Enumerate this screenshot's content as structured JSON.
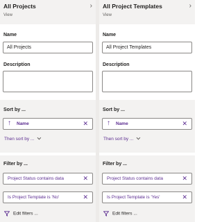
{
  "panels": [
    {
      "title": "All Projects",
      "subtitle": "View",
      "name_label": "Name",
      "name_value": "All Projects",
      "description_label": "Description",
      "description_value": "",
      "sort_label": "Sort by ...",
      "sort_field": "Name",
      "then_sort_label": "Then sort by ...",
      "filter_label": "Filter by ...",
      "filters": [
        "Project Status contains data",
        "Is Project Template is 'No'"
      ],
      "edit_filters_label": "Edit filters ..."
    },
    {
      "title": "All Project Templates",
      "subtitle": "View",
      "name_label": "Name",
      "name_value": "All Project Templates",
      "description_label": "Description",
      "description_value": "",
      "sort_label": "Sort by ...",
      "sort_field": "Name",
      "then_sort_label": "Then sort by ...",
      "filter_label": "Filter by ...",
      "filters": [
        "Project Status contains data",
        "Is Project Template is 'Yes'"
      ],
      "edit_filters_label": "Edit filters ..."
    }
  ],
  "icons": {
    "chevron": "chevron-right-icon",
    "sort_arrow": "arrow-up-icon",
    "remove": "close-icon",
    "filter": "funnel-icon",
    "dropdown": "chevron-down-icon"
  },
  "colors": {
    "accent": "#5c2d91",
    "section_bg": "#f3f2f1",
    "border": "#8a8886"
  }
}
